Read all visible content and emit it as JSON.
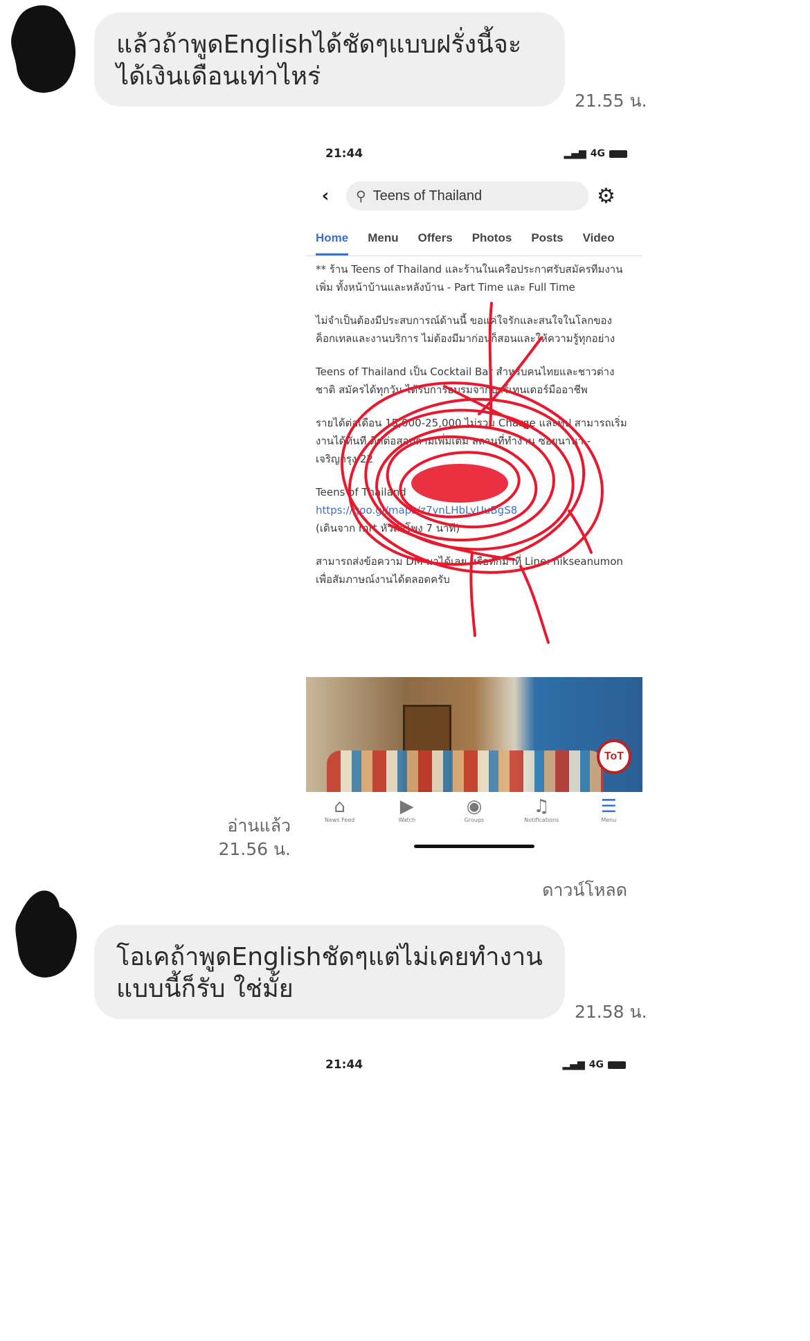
{
  "messages": [
    {
      "text": "แล้วถ้าพูดEnglishได้ชัดๆแบบฝรั่งนี้จะได้เงินเดือนเท่าไหร่",
      "time": "21.55 น."
    },
    {
      "text": "โอเคถ้าพูดEnglishชัดๆแต่ไม่เคยทำงานแบบนี้ก็รับ ใช่มั้ย",
      "time": "21.58 น."
    }
  ],
  "sent": {
    "read_label": "อ่านแล้ว",
    "time": "21.56 น.",
    "download_label": "ดาวน์โหลด"
  },
  "screenshot": {
    "clock": "21:44",
    "network": "4G",
    "search_text": "Teens of Thailand",
    "tabs": [
      "Home",
      "Menu",
      "Offers",
      "Photos",
      "Posts",
      "Video"
    ],
    "paragraphs": [
      "** ร้าน Teens of Thailand และร้านในเครือประกาศรับสมัครทีมงานเพิ่ม ทั้งหน้าบ้านและหลังบ้าน - Part Time และ Full Time",
      "ไม่จำเป็นต้องมีประสบการณ์ด้านนี้ ขอแค่ใจรักและสนใจในโลกของค็อกเทลและงานบริการ ไม่ต้องมีมาก่อนก็สอนและให้ความรู้ทุกอย่าง",
      "Teens of Thailand เป็น Cocktail Bar สำหรับคนไทยและชาวต่างชาติ สมัครได้ทุกวัน ได้รับการอบรมจากบาร์เทนเดอร์มืออาชีพ",
      "รายได้ต่อเดือน 15,000-25,000 ไม่รวม Charge และทิป สามารถเริ่มงานได้ทันที ติดต่อสอบถามเพิ่มเติม สถานที่ทำงาน ซอยนานา - เจริญกรุง 22"
    ],
    "location_name": "Teens of Thailand",
    "map_link": "https://goo.gl/maps/z7ynLHbLyUuBgS8",
    "walk_note": "(เดินจาก mrt หัวลำโพง 7 นาที)",
    "contact": "สามารถส่งข้อความ DM มาได้เลย หรือทักมาที่ Line: nikseanumon เพื่อสัมภาษณ์งานได้ตลอดครับ",
    "logo_text": "ToT",
    "nav": [
      "News Feed",
      "Watch",
      "Groups",
      "Notifications",
      "Menu"
    ],
    "nav_icons": [
      "home-icon",
      "watch-icon",
      "groups-icon",
      "bell-icon",
      "menu-icon"
    ]
  },
  "bottom_status": {
    "clock": "21:44",
    "network": "4G"
  },
  "colors": {
    "bubble": "#efefef",
    "link": "#3b6fc9",
    "scribble": "#e8192c"
  }
}
